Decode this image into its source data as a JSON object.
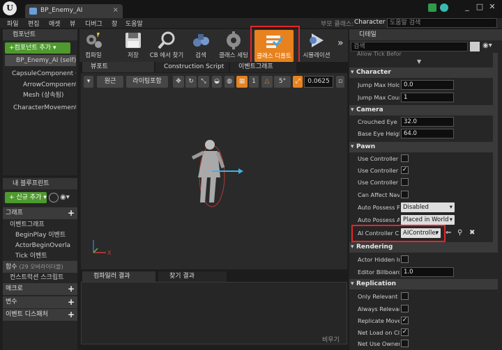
{
  "window": {
    "tab_title": "BP_Enemy_AI",
    "parent_class_label": "부모 클래스:",
    "parent_class_value": "Character",
    "help_search_placeholder": "도움말 검색"
  },
  "menu": [
    "파일",
    "편집",
    "애셋",
    "뷰",
    "디버그",
    "창",
    "도움말"
  ],
  "components_panel": {
    "title": "컴포넌트",
    "add_button": "+컴포넌트 추가 ▾",
    "root": "BP_Enemy_AI (self)",
    "items": [
      "CapsuleComponent (",
      "ArrowComponent (",
      "Mesh (상속됨)",
      "CharacterMovement"
    ]
  },
  "blueprint_panel": {
    "title": "내 블루프린트",
    "add_new": "+ 신규 추가 ▾",
    "graph_section": "그래프",
    "event_graph": "이벤트그래프",
    "events": [
      "BeginPlay 이벤트",
      "ActorBeginOverla",
      "Tick 이벤트"
    ],
    "functions_section": "함수",
    "functions_count": "(29 오버라이더블)",
    "construction_script": "컨스트럭션 스크립트",
    "macros": "매크로",
    "variables": "변수",
    "event_dispatchers": "이벤트 디스패처"
  },
  "toolbar": {
    "buttons": [
      {
        "label": "컴파일",
        "icon": "compile-icon"
      },
      {
        "label": "저장",
        "icon": "save-icon"
      },
      {
        "label": "CB 에서 찾기",
        "icon": "find-in-cb-icon"
      },
      {
        "label": "검색",
        "icon": "search-icon"
      },
      {
        "label": "클래스 세팅",
        "icon": "class-settings-icon"
      },
      {
        "label": "클래스 디폴트",
        "icon": "class-defaults-icon"
      },
      {
        "label": "시뮬레이션",
        "icon": "simulation-icon"
      }
    ],
    "highlight_color": "#e3262a",
    "active_color": "#e8821e"
  },
  "viewport": {
    "tabs": [
      "뷰포트",
      "Construction Script",
      "이벤트그래프"
    ],
    "perspective": "원근",
    "lighting": "라이팅포함",
    "grid_snap": "5°",
    "angle_snap": "1",
    "scale_snap": "0.0625"
  },
  "bottom": {
    "tabs": [
      "컴파일러 결과",
      "찾기 결과"
    ],
    "clear_label": "비우기"
  },
  "details": {
    "title": "디테일",
    "search_placeholder": "검색",
    "truncated_row": "Allow Tick Befor",
    "categories": {
      "character": {
        "title": "Character",
        "rows": [
          {
            "label": "Jump Max Hold",
            "value": "0.0"
          },
          {
            "label": "Jump Max Coun",
            "value": "1"
          }
        ]
      },
      "camera": {
        "title": "Camera",
        "rows": [
          {
            "label": "Crouched Eye He",
            "value": "32.0"
          },
          {
            "label": "Base Eye Height",
            "value": "64.0"
          }
        ]
      },
      "pawn": {
        "title": "Pawn",
        "rows": [
          {
            "label": "Use Controller R",
            "checked": false
          },
          {
            "label": "Use Controller R",
            "checked": true
          },
          {
            "label": "Use Controller R",
            "checked": false
          },
          {
            "label": "Can Affect Navig",
            "checked": false
          },
          {
            "label": "Auto Possess Pl",
            "value": "Disabled"
          },
          {
            "label": "Auto Possess AI",
            "value": "Placed in World"
          },
          {
            "label": "AI Controller Cla",
            "value": "AIController"
          }
        ]
      },
      "rendering": {
        "title": "Rendering",
        "rows": [
          {
            "label": "Actor Hidden In",
            "checked": false
          },
          {
            "label": "Editor Billboard S",
            "value": "1.0"
          }
        ]
      },
      "replication": {
        "title": "Replication",
        "rows": [
          {
            "label": "Only Relevant to",
            "checked": false
          },
          {
            "label": "Always Relevant",
            "checked": false
          },
          {
            "label": "Replicate Mover",
            "checked": true
          },
          {
            "label": "Net Load on Clie",
            "checked": true
          },
          {
            "label": "Net Use Owner R",
            "checked": false
          }
        ]
      }
    }
  }
}
